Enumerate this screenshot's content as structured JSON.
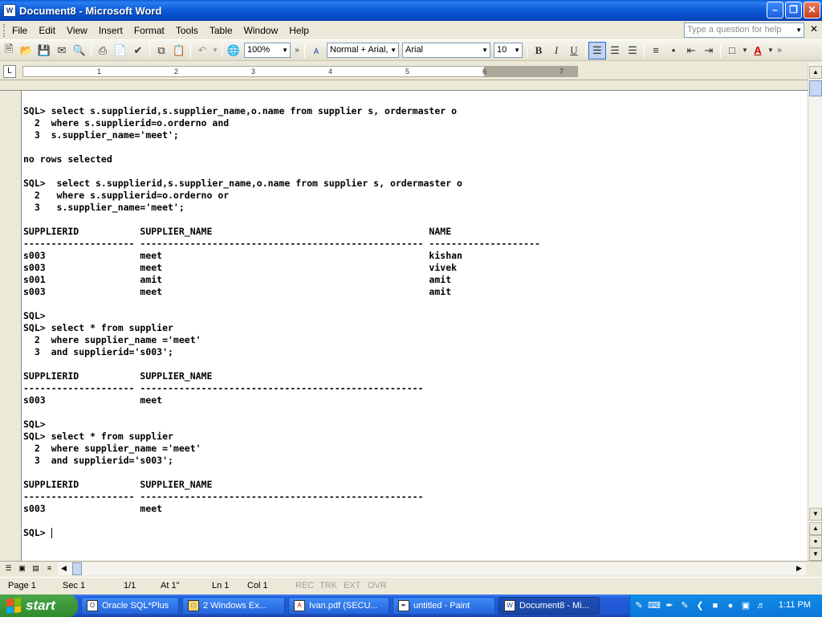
{
  "window": {
    "title": "Document8 - Microsoft Word",
    "app_icon": "word-icon",
    "controls": [
      "minimize",
      "maximize",
      "close"
    ]
  },
  "menubar": {
    "items": [
      "File",
      "Edit",
      "View",
      "Insert",
      "Format",
      "Tools",
      "Table",
      "Window",
      "Help"
    ],
    "help_placeholder": "Type a question for help"
  },
  "toolbar": {
    "zoom": "100%",
    "style": "Normal + Arial,",
    "font": "Arial",
    "font_size": "10",
    "bold": "B",
    "italic": "I",
    "underline": "U"
  },
  "ruler": {
    "numbers": [
      "1",
      "2",
      "3",
      "4",
      "5",
      "6",
      "7"
    ]
  },
  "document": {
    "lines": [
      "SQL> select s.supplierid,s.supplier_name,o.name from supplier s, ordermaster o",
      "  2  where s.supplierid=o.orderno and",
      "  3  s.supplier_name='meet';",
      "",
      "no rows selected",
      "",
      "SQL>  select s.supplierid,s.supplier_name,o.name from supplier s, ordermaster o",
      "  2   where s.supplierid=o.orderno or",
      "  3   s.supplier_name='meet';",
      "",
      "SUPPLIERID           SUPPLIER_NAME                                       NAME",
      "-------------------- --------------------------------------------------- --------------------",
      "s003                 meet                                                kishan",
      "s003                 meet                                                vivek",
      "s001                 amit                                                amit",
      "s003                 meet                                                amit",
      "",
      "SQL>",
      "SQL> select * from supplier",
      "  2  where supplier_name ='meet'",
      "  3  and supplierid='s003';",
      "",
      "SUPPLIERID           SUPPLIER_NAME",
      "-------------------- ---------------------------------------------------",
      "s003                 meet",
      "",
      "SQL>",
      "SQL> select * from supplier",
      "  2  where supplier_name ='meet'",
      "  3  and supplierid='s003';",
      "",
      "SUPPLIERID           SUPPLIER_NAME",
      "-------------------- ---------------------------------------------------",
      "s003                 meet",
      "",
      "SQL> "
    ]
  },
  "statusbar": {
    "page": "Page 1",
    "sec": "Sec 1",
    "pages": "1/1",
    "at": "At 1\"",
    "ln": "Ln 1",
    "col": "Col 1",
    "rec": "REC",
    "trk": "TRK",
    "ext": "EXT",
    "ovr": "OVR"
  },
  "taskbar": {
    "start": "start",
    "tasks": [
      {
        "label": "Oracle SQL*Plus",
        "icon": "oracle-icon"
      },
      {
        "label": "2 Windows Ex...",
        "icon": "folder-icon"
      },
      {
        "label": "Ivan.pdf (SECU...",
        "icon": "pdf-icon"
      },
      {
        "label": "untitled - Paint",
        "icon": "paint-icon"
      },
      {
        "label": "Document8 - Mi...",
        "icon": "word-icon"
      }
    ],
    "clock": "1:11 PM"
  }
}
